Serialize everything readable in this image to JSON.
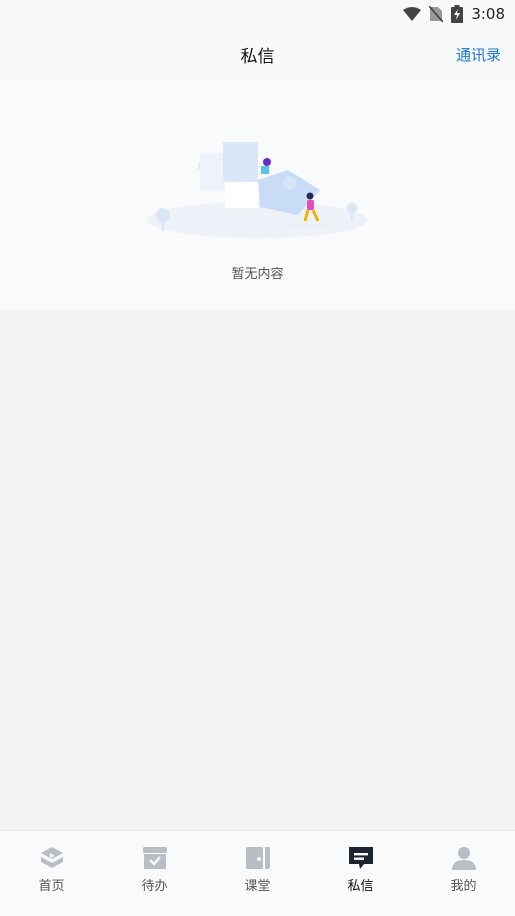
{
  "status_bar": {
    "time": "3:08"
  },
  "header": {
    "title": "私信",
    "contacts_label": "通讯录"
  },
  "empty_state": {
    "text": "暂无内容"
  },
  "tabbar": {
    "items": [
      {
        "label": "首页",
        "icon": "home-icon",
        "active": false
      },
      {
        "label": "待办",
        "icon": "todo-icon",
        "active": false
      },
      {
        "label": "课堂",
        "icon": "classroom-icon",
        "active": false
      },
      {
        "label": "私信",
        "icon": "message-icon",
        "active": true
      },
      {
        "label": "我的",
        "icon": "profile-icon",
        "active": false
      }
    ]
  },
  "colors": {
    "accent": "#1677d2",
    "inactive_icon": "#b9bec4",
    "active_icon": "#1c2430",
    "background": "#f2f4f6"
  }
}
